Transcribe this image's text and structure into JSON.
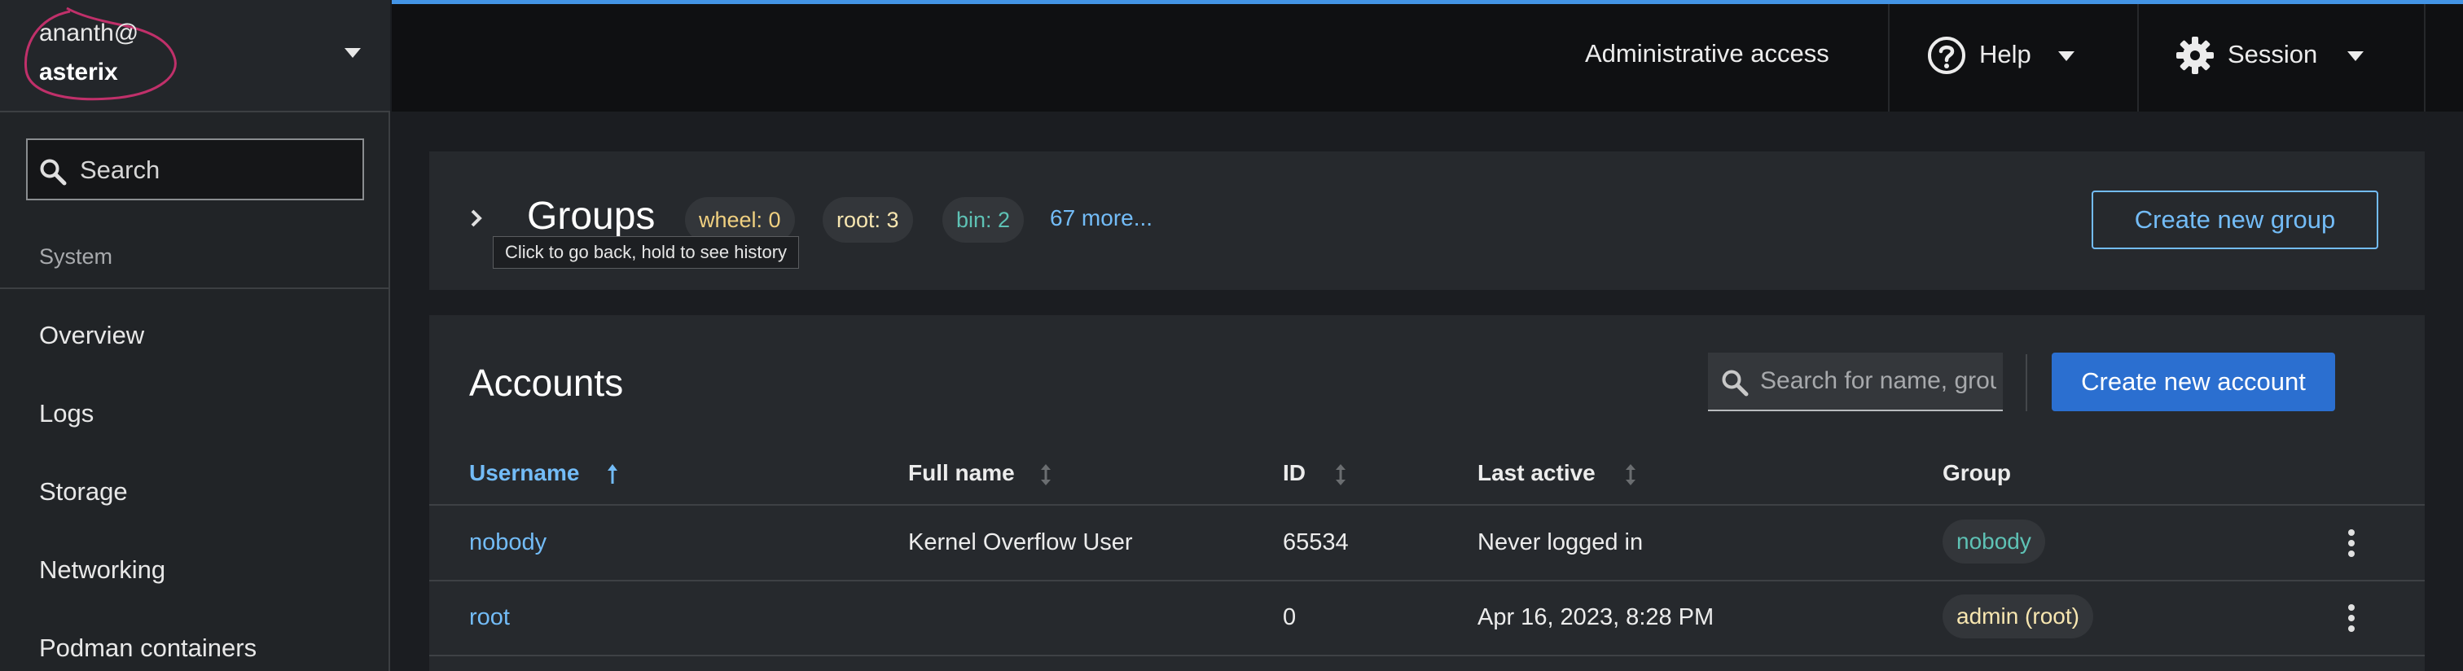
{
  "host": {
    "user": "ananth@",
    "name": "asterix"
  },
  "sidebar": {
    "search_label": "Search",
    "section": "System",
    "items": [
      "Overview",
      "Logs",
      "Storage",
      "Networking",
      "Podman containers"
    ]
  },
  "topbar": {
    "admin": "Administrative access",
    "help": "Help",
    "session": "Session",
    "accent_color": "#4394e5"
  },
  "groups": {
    "title": "Groups",
    "pills": [
      {
        "label": "wheel: 0",
        "color": "#f0d080"
      },
      {
        "label": "root: 3",
        "color": "#f7e6b0"
      },
      {
        "label": "bin: 2",
        "color": "#5ec2b5"
      }
    ],
    "more": "67 more...",
    "tooltip": "Click to go back, hold to see history",
    "create_button": "Create new group"
  },
  "accounts": {
    "title": "Accounts",
    "search_placeholder": "Search for name, grou...",
    "create_button": "Create new account",
    "columns": [
      "Username",
      "Full name",
      "ID",
      "Last active",
      "Group"
    ],
    "rows": [
      {
        "username": "nobody",
        "full_name": "Kernel Overflow User",
        "id": "65534",
        "last_active": "Never logged in",
        "group": "nobody",
        "group_color": "#5ec2b5"
      },
      {
        "username": "root",
        "full_name": "",
        "id": "0",
        "last_active": "Apr 16, 2023, 8:28 PM",
        "group": "admin (root)",
        "group_color": "#f7e6b0"
      }
    ]
  }
}
